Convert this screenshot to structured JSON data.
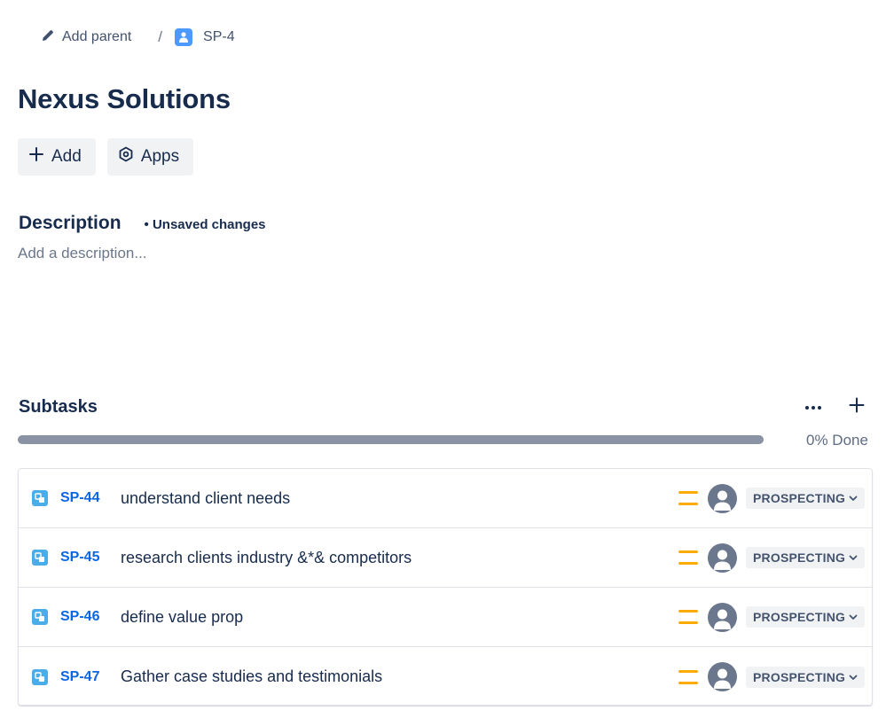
{
  "breadcrumb": {
    "add_parent_label": "Add parent",
    "separator": "/",
    "issue_key": "SP-4"
  },
  "title": "Nexus Solutions",
  "actions": {
    "add_label": "Add",
    "apps_label": "Apps"
  },
  "description": {
    "heading": "Description",
    "unsaved_label": "• Unsaved changes",
    "placeholder": "Add a description..."
  },
  "subtasks": {
    "heading": "Subtasks",
    "more_icon": "ellipsis-icon",
    "add_icon": "plus-icon",
    "progress_percent": 0,
    "progress_label": "0% Done",
    "items": [
      {
        "key": "SP-44",
        "summary": "understand client needs",
        "priority": "medium",
        "status": "PROSPECTING"
      },
      {
        "key": "SP-45",
        "summary": "research clients industry &*& competitors",
        "priority": "medium",
        "status": "PROSPECTING"
      },
      {
        "key": "SP-46",
        "summary": "define value prop",
        "priority": "medium",
        "status": "PROSPECTING"
      },
      {
        "key": "SP-47",
        "summary": "Gather case studies and testimonials",
        "priority": "medium",
        "status": "PROSPECTING"
      }
    ]
  },
  "colors": {
    "link": "#0c66e4",
    "priority_medium": "#ffab00",
    "subtask_icon": "#4bade8",
    "issue_type_icon": "#4c9aff",
    "progress_track": "#8993a4"
  }
}
